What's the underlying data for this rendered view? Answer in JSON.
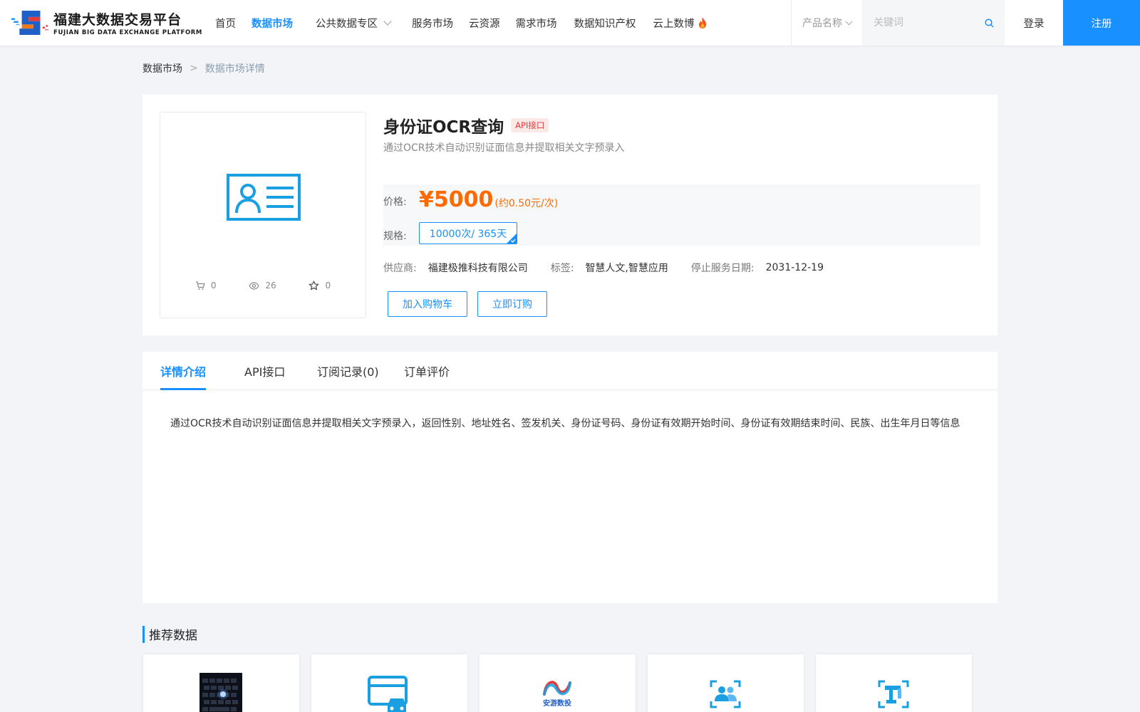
{
  "header": {
    "logo_cn": "福建大数据交易平台",
    "logo_en": "FUJIAN BIG DATA EXCHANGE  PLATFORM",
    "nav": [
      {
        "label": "首页",
        "active": false
      },
      {
        "label": "数据市场",
        "active": true
      },
      {
        "label": "公共数据专区",
        "dropdown": true
      },
      {
        "label": "服务市场"
      },
      {
        "label": "云资源"
      },
      {
        "label": "需求市场"
      },
      {
        "label": "数据知识产权"
      },
      {
        "label": "云上数博",
        "hot": true
      }
    ],
    "search_type": "产品名称",
    "search_placeholder": "关键词",
    "login": "登录",
    "register": "注册"
  },
  "breadcrumb": {
    "home": "数据市场",
    "separator": ">",
    "current": "数据市场详情"
  },
  "product": {
    "title": "身份证OCR查询",
    "badge": "API接口",
    "subtitle": "通过OCR技术自动识别证面信息并提取相关文字预录入",
    "stats": {
      "cart": "0",
      "views": "26",
      "favorites": "0"
    },
    "price_label": "价格:",
    "price": "¥5000",
    "price_note": "(约0.50元/次)",
    "spec_label": "规格:",
    "spec_option": "10000次/ 365天",
    "supplier_label": "供应商:",
    "supplier": "福建极推科技有限公司",
    "tags_label": "标签:",
    "tags": "智慧人文,智慧应用",
    "stop_label": "停止服务日期:",
    "stop_date": "2031-12-19",
    "btn_cart": "加入购物车",
    "btn_buy": "立即订购"
  },
  "tabs": [
    {
      "label": "详情介绍",
      "active": true
    },
    {
      "label": "API接口"
    },
    {
      "label": "订阅记录(0)"
    },
    {
      "label": "订单评价"
    }
  ],
  "detail_text": "通过OCR技术自动识别证面信息并提取相关文字预录入，返回性别、地址姓名、签发机关、身份证号码、身份证有效期开始时间、身份证有效期结束时间、民族、出生年月日等信息",
  "recommend": {
    "title": "推荐数据",
    "thumb_text_3": "安游数投"
  },
  "colors": {
    "accent": "#1890ff",
    "price": "#ff6a00",
    "badge_red": "#e23b3b"
  }
}
